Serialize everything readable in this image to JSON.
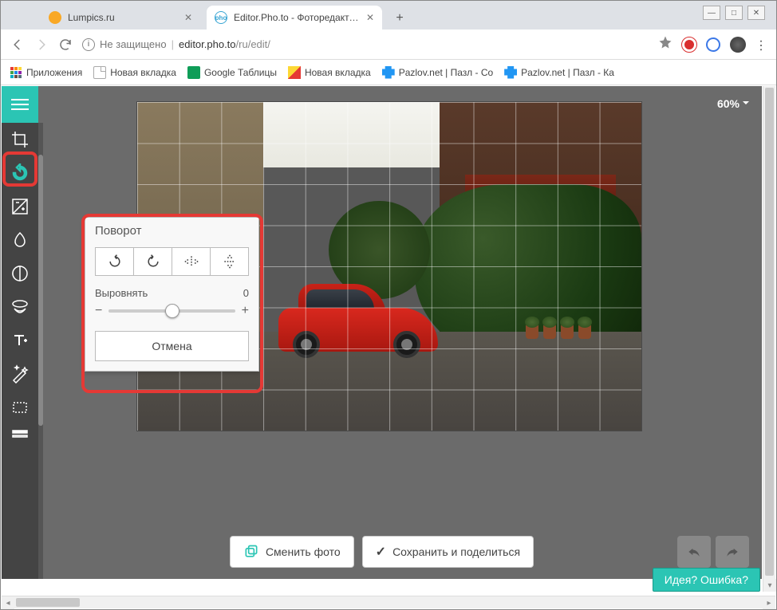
{
  "browser": {
    "tabs": [
      {
        "title": "Lumpics.ru"
      },
      {
        "title": "Editor.Pho.to - Фоторедактор он"
      }
    ],
    "url_insecure": "Не защищено",
    "url_host": "editor.pho.to",
    "url_path": "/ru/edit/",
    "bookmarks": {
      "apps": "Приложения",
      "items": [
        "Новая вкладка",
        "Google Таблицы",
        "Новая вкладка",
        "Pazlov.net | Пазл - Со",
        "Pazlov.net | Пазл - Ка"
      ]
    }
  },
  "editor": {
    "zoom": "60%",
    "panel": {
      "title": "Поворот",
      "straighten_label": "Выровнять",
      "straighten_value": "0",
      "cancel": "Отмена"
    },
    "actions": {
      "change": "Сменить фото",
      "save": "Сохранить и поделиться"
    },
    "feedback": "Идея? Ошибка?"
  }
}
